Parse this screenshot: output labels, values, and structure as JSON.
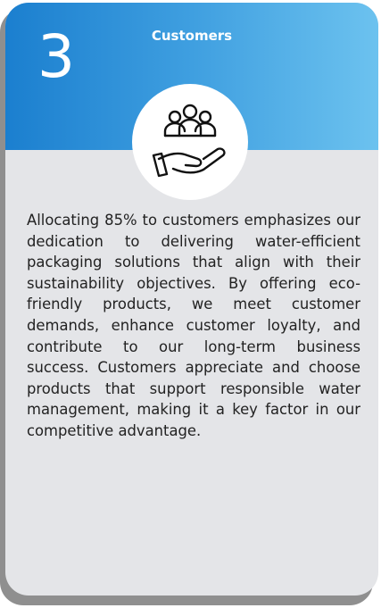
{
  "card": {
    "number": "3",
    "title": "Customers",
    "icon": "customer-care-hand-icon",
    "description": "Allocating 85% to customers emphasizes our dedication to delivering water-efficient packaging solutions that align with their sustainability objectives. By offering eco-friendly products, we meet customer demands, enhance customer loyalty, and contribute to our long-term business success. Customers appreciate and choose products that support responsible water management, making it a key factor in our competitive advantage."
  },
  "colors": {
    "header_gradient_start": "#1b7fcf",
    "header_gradient_end": "#6cc2ef",
    "card_background": "#e4e5e8",
    "text": "#222222"
  }
}
